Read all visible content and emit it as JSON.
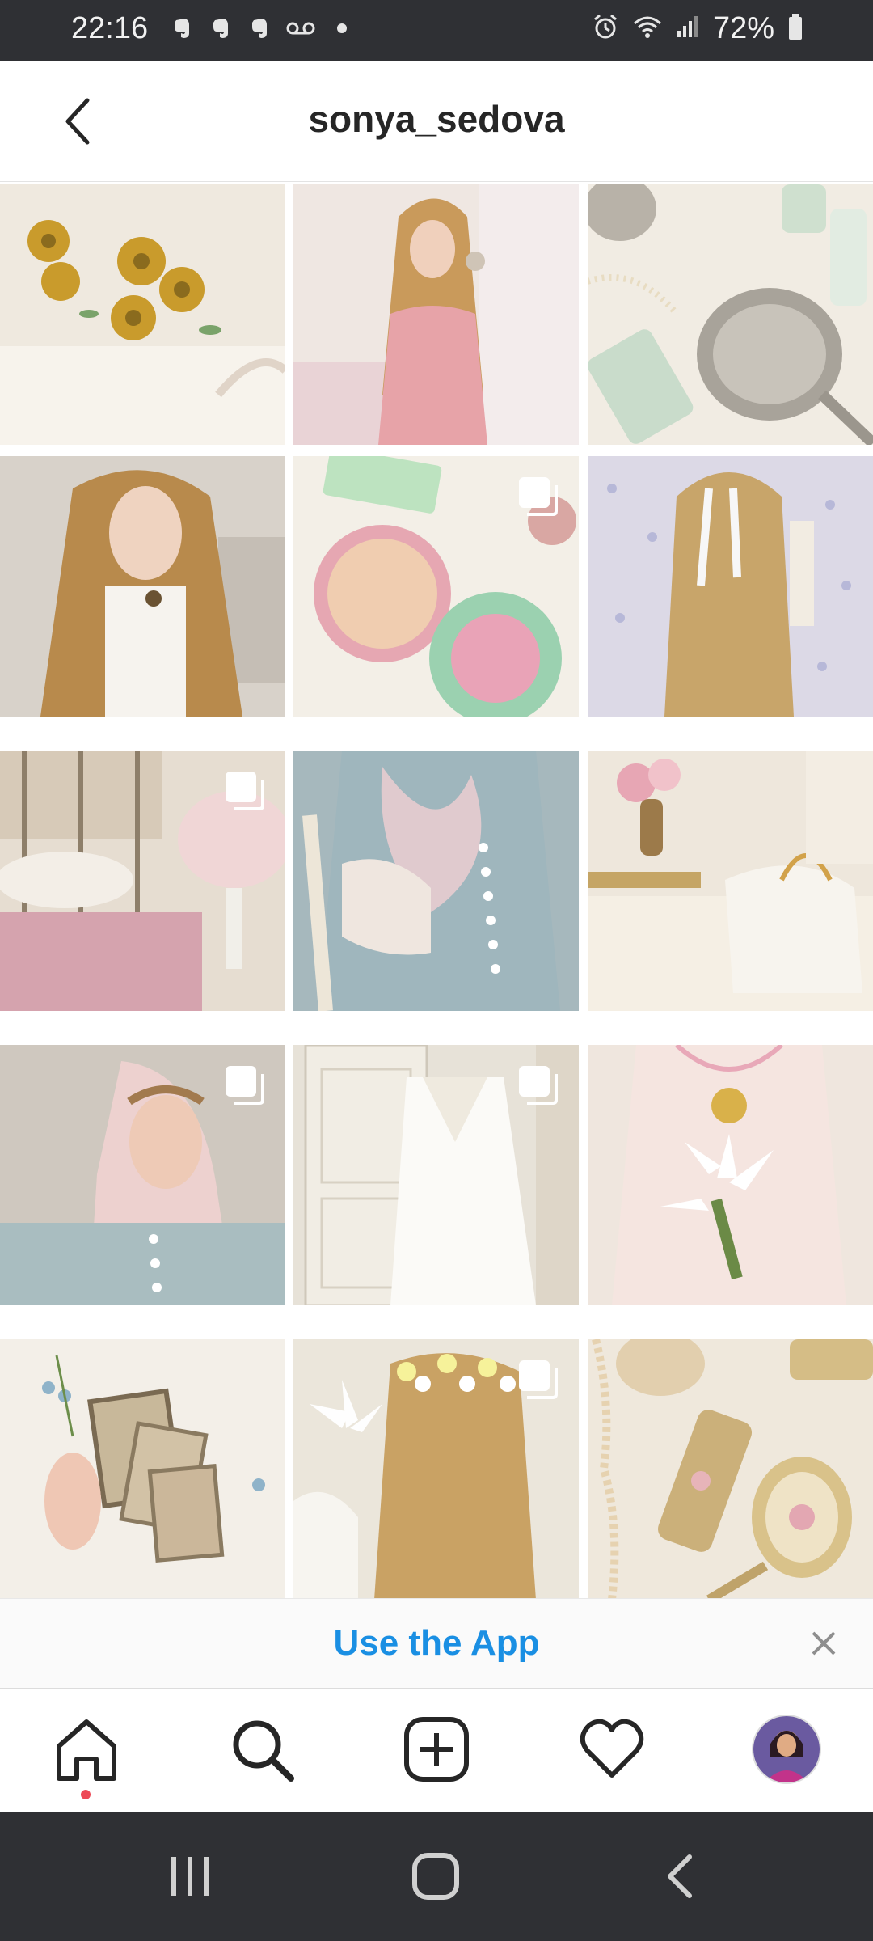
{
  "status_bar": {
    "time": "22:16",
    "battery_percent": "72%",
    "left_icons": [
      "evernote-icon",
      "evernote-icon",
      "evernote-icon",
      "voicemail-icon",
      "dot-icon"
    ],
    "right_icons": [
      "alarm-icon",
      "wifi-icon",
      "signal-icon",
      "battery-icon"
    ]
  },
  "header": {
    "username": "sonya_sedova",
    "back_icon": "chevron-left-icon"
  },
  "grid": {
    "posts": [
      {
        "subject": "gold flower brooches on lace",
        "multi": false
      },
      {
        "subject": "girl in pink dress with long hair",
        "multi": false
      },
      {
        "subject": "silver hand mirror and pearls",
        "multi": false
      },
      {
        "subject": "portrait with wavy hair and lace blouse",
        "multi": false
      },
      {
        "subject": "rose compact powder",
        "multi": true
      },
      {
        "subject": "back of hair with white ribbon",
        "multi": false
      },
      {
        "subject": "floral bedroom with lamp",
        "multi": true
      },
      {
        "subject": "blue blouse with pink scarf and glove",
        "multi": false
      },
      {
        "subject": "vanity with roses and bag",
        "multi": false
      },
      {
        "subject": "portrait with pink headscarf",
        "multi": true
      },
      {
        "subject": "white nightgown on wardrobe door",
        "multi": true
      },
      {
        "subject": "lace dress with lilies",
        "multi": false
      },
      {
        "subject": "old photographs on embroidered cloth",
        "multi": false
      },
      {
        "subject": "hair with flowers and lily",
        "multi": true
      },
      {
        "subject": "gold vanity set and pearls",
        "multi": false
      }
    ]
  },
  "app_banner": {
    "label": "Use the App",
    "close_icon": "close-icon"
  },
  "bottom_nav": {
    "items": [
      "home-icon",
      "search-icon",
      "new-post-icon",
      "activity-heart-icon",
      "profile-avatar"
    ]
  },
  "system_nav": {
    "items": [
      "recent-apps-icon",
      "home-button-icon",
      "back-icon"
    ]
  },
  "colors": {
    "accent_blue": "#1a8fe3",
    "notification_red": "#ed4956",
    "system_bar": "#2f3034",
    "text_dark": "#262626"
  }
}
